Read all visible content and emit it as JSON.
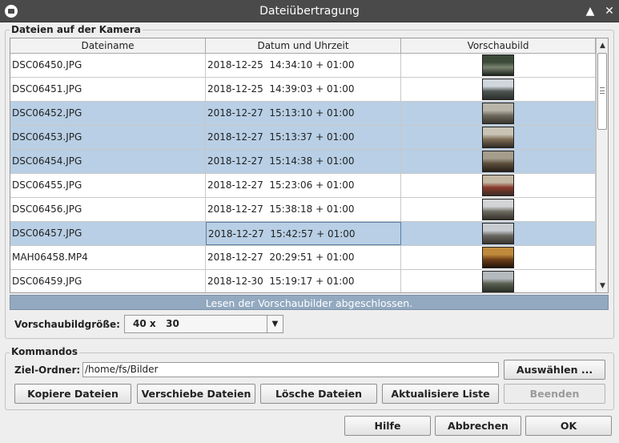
{
  "window": {
    "title": "Dateiübertragung",
    "minimize_glyph": "▲",
    "close_glyph": "✕"
  },
  "camera_group": {
    "title": "Dateien auf der Kamera",
    "columns": [
      "Dateiname",
      "Datum und Uhrzeit",
      "Vorschaubild"
    ],
    "rows": [
      {
        "name": "DSC06450.JPG",
        "date": "2018-12-25  14:34:10 + 01:00",
        "selected": false,
        "thumb_colors": [
          "#3c4a3a",
          "#7a8470",
          "#1d241c"
        ]
      },
      {
        "name": "DSC06451.JPG",
        "date": "2018-12-25  14:39:03 + 01:00",
        "selected": false,
        "thumb_colors": [
          "#cfd6dc",
          "#4d5550",
          "#2a2f2c"
        ]
      },
      {
        "name": "DSC06452.JPG",
        "date": "2018-12-27  15:13:10 + 01:00",
        "selected": true,
        "thumb_colors": [
          "#b9b4a8",
          "#6e6a5e",
          "#3a362e"
        ]
      },
      {
        "name": "DSC06453.JPG",
        "date": "2018-12-27  15:13:37 + 01:00",
        "selected": true,
        "thumb_colors": [
          "#c9c3b5",
          "#7d6a52",
          "#2e2a24"
        ]
      },
      {
        "name": "DSC06454.JPG",
        "date": "2018-12-27  15:14:38 + 01:00",
        "selected": true,
        "thumb_colors": [
          "#a59c8c",
          "#5c4e3c",
          "#282018"
        ]
      },
      {
        "name": "DSC06455.JPG",
        "date": "2018-12-27  15:23:06 + 01:00",
        "selected": false,
        "thumb_colors": [
          "#c4b8a4",
          "#8a3a2c",
          "#3a2e26"
        ]
      },
      {
        "name": "DSC06456.JPG",
        "date": "2018-12-27  15:38:18 + 01:00",
        "selected": false,
        "thumb_colors": [
          "#d2d4d6",
          "#6c6a60",
          "#34302a"
        ]
      },
      {
        "name": "DSC06457.JPG",
        "date": "2018-12-27  15:42:57 + 01:00",
        "selected": true,
        "focused": true,
        "thumb_colors": [
          "#c8ccd0",
          "#6a6862",
          "#3a3630"
        ]
      },
      {
        "name": "MAH06458.MP4",
        "date": "2018-12-27  20:29:51 + 01:00",
        "selected": false,
        "thumb_colors": [
          "#c08a3c",
          "#6e3e18",
          "#241408"
        ]
      },
      {
        "name": "DSC06459.JPG",
        "date": "2018-12-30  15:19:17 + 01:00",
        "selected": false,
        "thumb_colors": [
          "#b4babe",
          "#5a6050",
          "#2c3028"
        ]
      }
    ],
    "scrollbar": {
      "up": "▲",
      "down": "▼"
    },
    "status": "Lesen der Vorschaubilder abgeschlossen.",
    "thumb_size_label": "Vorschaubildgröße:",
    "thumb_size_value": "40 x   30",
    "combo_arrow": "▼"
  },
  "commands_group": {
    "title": "Kommandos",
    "target_label": "Ziel-Ordner:",
    "target_value": "/home/fs/Bilder",
    "choose_button": "Auswählen ...",
    "copy_button": "Kopiere Dateien",
    "move_button": "Verschiebe Dateien",
    "delete_button": "Lösche Dateien",
    "refresh_button": "Aktualisiere Liste",
    "stop_button": "Beenden"
  },
  "footer": {
    "help_button": "Hilfe",
    "cancel_button": "Abbrechen",
    "ok_button": "OK"
  },
  "colors": {
    "titlebar": "#4a4a4a",
    "selection": "#b8cfe5",
    "status_bar": "#92a9c0"
  }
}
